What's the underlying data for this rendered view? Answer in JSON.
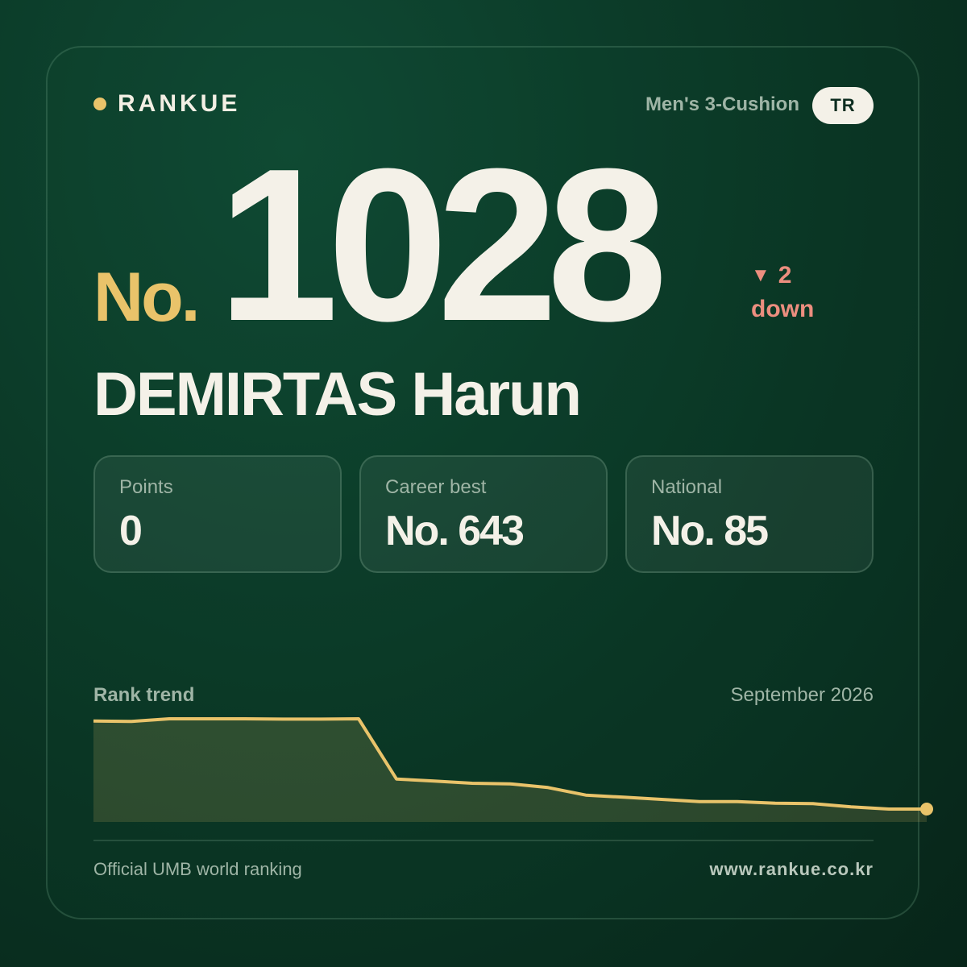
{
  "brand": {
    "name": "RANKUE"
  },
  "category": "Men's 3-Cushion",
  "country": "TR",
  "rank": {
    "prefix": "No.",
    "value": "1028",
    "change_amount": "2",
    "change_direction": "down"
  },
  "player": {
    "name": "DEMIRTAS Harun"
  },
  "stats": [
    {
      "label": "Points",
      "value": "0"
    },
    {
      "label": "Career best",
      "value": "No. 643"
    },
    {
      "label": "National",
      "value": "No. 85"
    }
  ],
  "trend": {
    "title": "Rank trend",
    "date": "September 2026"
  },
  "footer": {
    "source": "Official UMB world ranking",
    "url": "www.rankue.co.kr"
  },
  "colors": {
    "accent_gold": "#e9c36a",
    "down_red": "#ec8e7f",
    "text_light": "#f4f1e8",
    "background": "#0b3826"
  },
  "chart_data": {
    "type": "area",
    "title": "Rank trend",
    "y_inverted": true,
    "ylim": [
      1040,
      935
    ],
    "values": [
      946,
      946.5,
      944,
      944,
      944,
      944.3,
      944.3,
      944,
      1000,
      1002,
      1004,
      1004.5,
      1008,
      1015,
      1017,
      1019,
      1021,
      1021,
      1022.5,
      1023,
      1026,
      1028,
      1028
    ],
    "grid": false,
    "legend": "none"
  }
}
